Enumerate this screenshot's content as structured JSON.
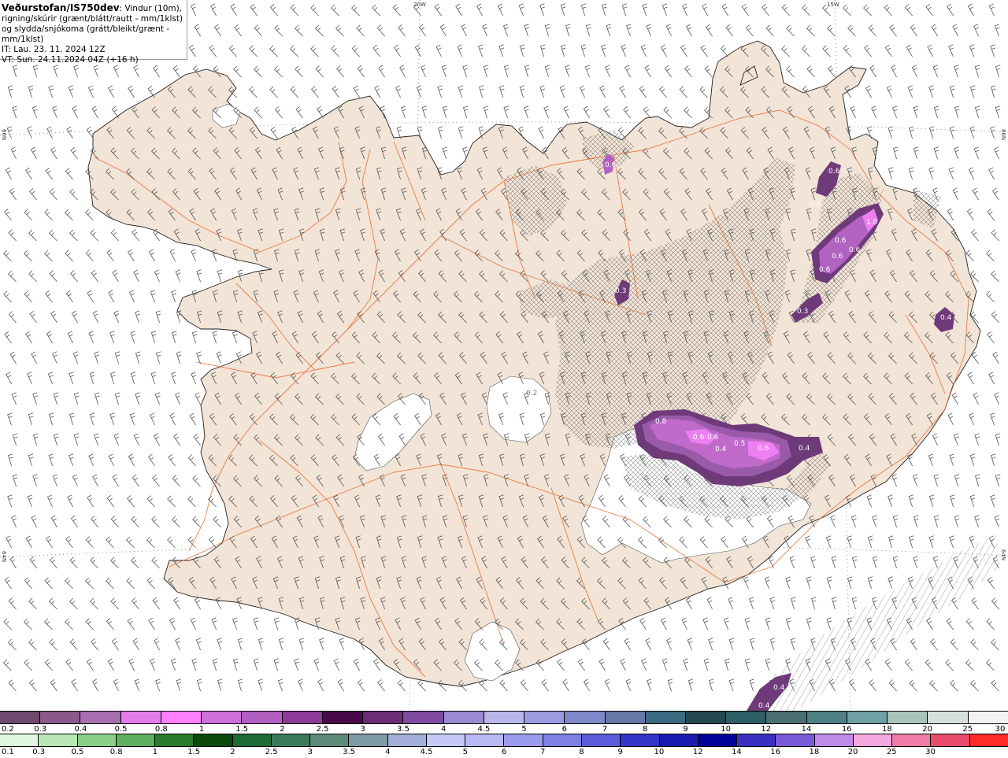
{
  "title": {
    "model": "Veðurstofan/IS750dev",
    "description": ": Vindur (10m), rigning/skúrir (grænt/blátt/rautt - mm/1klst) og slydda/snjókoma (grátt/bleikt/grænt - mm/1klst)",
    "issue_time": "IT: Lau. 23. 11. 2024 12Z",
    "valid_time": "VT: Sun. 24.11.2024 04Z (+16 h)"
  },
  "grid_labels": {
    "lon_20w": "20W",
    "lon_15w": "15W",
    "lat_66n_left": "66N",
    "lat_66n_right": "66N",
    "lat_64n_left": "64N",
    "lat_64n_right": "64N"
  },
  "precip_labels": [
    "0.6",
    "0.6",
    "0.6",
    "0.6",
    "0.6",
    "1.0",
    "0.6",
    "0.6",
    "0.3",
    "0.4",
    "0.3",
    "0.2",
    "0.8",
    "0.6",
    "0.6",
    "0.4",
    "0.5",
    "0.6",
    "0.4",
    "0.4",
    "0.4"
  ],
  "snow_scale": {
    "colors": [
      "#6e4a6e",
      "#8a5a8a",
      "#a86fb0",
      "#e27de8",
      "#ff80ff",
      "#cf6fd8",
      "#b25ec0",
      "#8e3a98",
      "#4a0a4a",
      "#6d2b78",
      "#7f4ba0",
      "#9a8ad2",
      "#b9b6ec",
      "#9a9ae0",
      "#7f88c9",
      "#6878a8",
      "#3a6a80",
      "#244850",
      "#2e5e66",
      "#4a6e73",
      "#4e8086",
      "#6ea0a3",
      "#a9c2bc",
      "#d6dfdb",
      "#f2f4f2"
    ],
    "labels": [
      "0.2",
      "0.3",
      "0.4",
      "0.5",
      "0.8",
      "1",
      "1.5",
      "2",
      "2.5",
      "3",
      "3.5",
      "4",
      "4.5",
      "5",
      "6",
      "7",
      "8",
      "9",
      "10",
      "12",
      "14",
      "16",
      "18",
      "20",
      "25",
      "30"
    ]
  },
  "rain_scale": {
    "colors": [
      "#e0f7e0",
      "#b8e6b4",
      "#8bce88",
      "#5fb05e",
      "#2c7a2c",
      "#0b4a0b",
      "#1f6b35",
      "#3c7a5a",
      "#5e8a7a",
      "#7f9aa7",
      "#a3afd8",
      "#c5c9f7",
      "#b8b8f4",
      "#9a9aef",
      "#7f7fe6",
      "#5c5cd8",
      "#3434c8",
      "#1a1ab0",
      "#00009a",
      "#3a30c0",
      "#7a5ad8",
      "#c08ae8",
      "#f5a8e0",
      "#f07aa8",
      "#e84b6a",
      "#ff2a2a"
    ],
    "labels": [
      "0.1",
      "0.3",
      "0.5",
      "0.8",
      "1",
      "1.5",
      "2",
      "2.5",
      "3",
      "3.5",
      "4",
      "4.5",
      "5",
      "6",
      "7",
      "8",
      "9",
      "10",
      "12",
      "14",
      "16",
      "18",
      "20",
      "25",
      "30"
    ]
  }
}
